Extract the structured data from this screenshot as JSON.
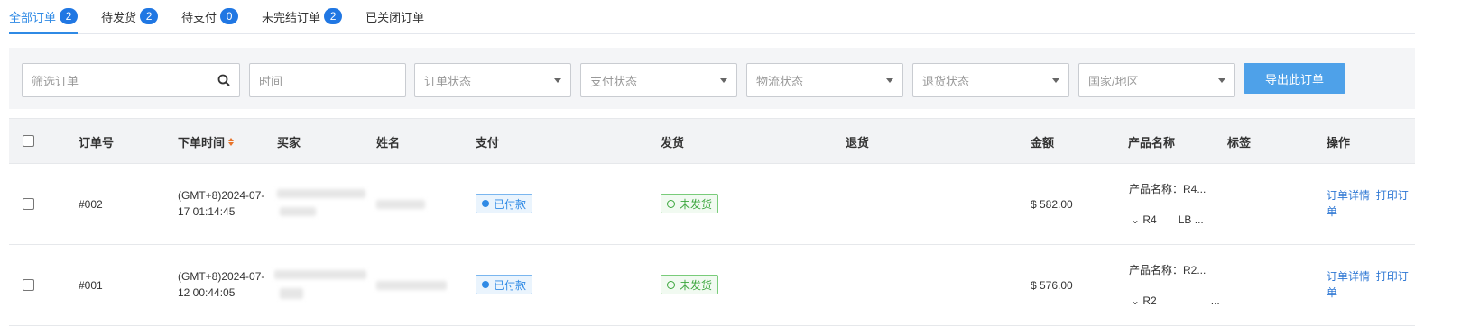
{
  "tabs": [
    {
      "label": "全部订单",
      "count": "2"
    },
    {
      "label": "待发货",
      "count": "2"
    },
    {
      "label": "待支付",
      "count": "0"
    },
    {
      "label": "未完结订单",
      "count": "2"
    },
    {
      "label": "已关闭订单",
      "count": ""
    }
  ],
  "filters": {
    "search_placeholder": "筛选订单",
    "time_placeholder": "时间",
    "order_status": "订单状态",
    "payment_status": "支付状态",
    "logistics_status": "物流状态",
    "return_status": "退货状态",
    "country": "国家/地区",
    "export_label": "导出此订单"
  },
  "columns": {
    "order_no": "订单号",
    "order_time": "下单时间",
    "buyer": "买家",
    "name": "姓名",
    "payment": "支付",
    "shipping": "发货",
    "returns": "退货",
    "amount": "金额",
    "product": "产品名称",
    "tags": "标签",
    "actions": "操作"
  },
  "rows": [
    {
      "order_no": "#002",
      "time_line1": "(GMT+8)2024-07-",
      "time_line2": "17 01:14:45",
      "payment": "已付款",
      "shipping": "未发货",
      "amount": "$ 582.00",
      "product_line1": "产品名称：R4...",
      "product_line2": "⌄ R4  LB ...",
      "detail_link": "订单详情",
      "print_link_1": "打印订",
      "print_link_2": "单"
    },
    {
      "order_no": "#001",
      "time_line1": "(GMT+8)2024-07-",
      "time_line2": "12 00:44:05",
      "payment": "已付款",
      "shipping": "未发货",
      "amount": "$ 576.00",
      "product_line1": "产品名称：R2...",
      "product_line2": "⌄ R2     ...",
      "detail_link": "订单详情",
      "print_link_1": "打印订",
      "print_link_2": "单"
    }
  ],
  "colors": {
    "accent": "#2f8ae5",
    "badge": "#2077e3",
    "export": "#4ea1e9",
    "paid": "#2f8ae5",
    "unshipped": "#3ba63d"
  }
}
